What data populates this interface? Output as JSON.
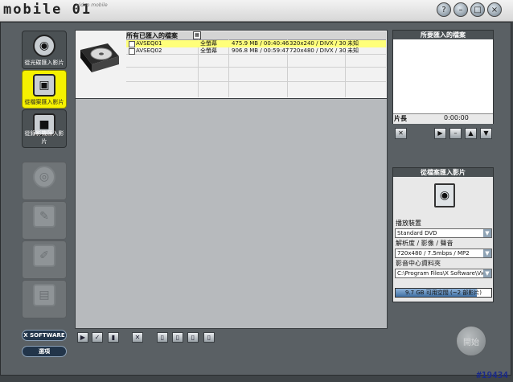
{
  "app": {
    "logo": "mobile 01",
    "logo_small": "video mobile",
    "window_buttons": [
      "help-icon",
      "minimize-icon",
      "restore-icon",
      "close-icon"
    ]
  },
  "nav": {
    "items": [
      {
        "label": "從光碟匯入影片",
        "icon": "disc-import-icon",
        "state": "normal"
      },
      {
        "label": "從檔案匯入影片",
        "icon": "file-import-icon",
        "state": "active"
      },
      {
        "label": "從錄影機匯入影片",
        "icon": "camcorder-icon",
        "state": "normal"
      },
      {
        "label": "",
        "icon": "disc-icon",
        "state": "disabled"
      },
      {
        "label": "",
        "icon": "edit-icon",
        "state": "disabled"
      },
      {
        "label": "",
        "icon": "write-icon",
        "state": "disabled"
      },
      {
        "label": "",
        "icon": "film-icon",
        "state": "disabled"
      }
    ],
    "xsoftware_label": "X SOFTWARE",
    "options_label": "選項"
  },
  "list": {
    "header": "所有已匯入的檔案",
    "rows": [
      {
        "name": "AVSEQ01",
        "mode": "全螢幕",
        "size": "475.9 MB / 00:40:46",
        "format": "320x240 / DIVX / 30",
        "status": "未知",
        "selected": true
      },
      {
        "name": "AVSEQ02",
        "mode": "全螢幕",
        "size": "906.8 MB / 00:59:47",
        "format": "720x480 / DIVX / 30",
        "status": "未知",
        "selected": false
      }
    ]
  },
  "toolbar": {
    "buttons": [
      "play-icon",
      "check-icon",
      "bar-icon",
      "delete-icon",
      "doc1-icon",
      "doc2-icon",
      "doc3-icon",
      "doc4-icon"
    ]
  },
  "preview": {
    "title": "所要匯入的檔案",
    "length_label": "片長",
    "length_value": "0:00:00"
  },
  "import": {
    "title": "從檔案匯入影片",
    "device_label": "播放裝置",
    "device_value": "Standard DVD",
    "quality_label": "解析度 / 影像 / 聲音",
    "quality_value": "720x480 / 7.5mbps / MP2",
    "folder_label": "影音中心資料夾",
    "folder_value": "C:\\Program Files\\X Software\\Video",
    "space_text": "9.7 GB 可用空間 (~2 部影片)",
    "space_fraction": 0.85
  },
  "start_label": "開始",
  "watermark": "#19434",
  "colors": {
    "accent_yellow": "#f5f100",
    "frame": "#5a6064",
    "selected_row": "#ffff7a"
  }
}
